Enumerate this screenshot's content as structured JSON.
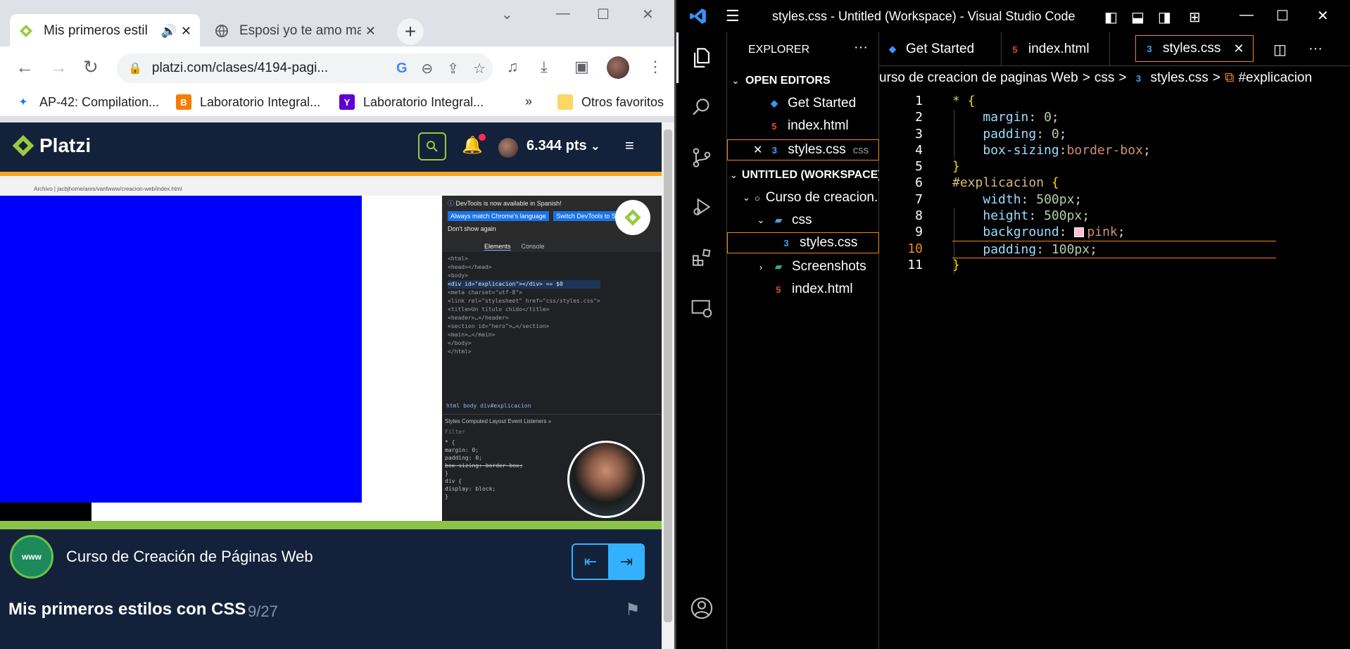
{
  "chrome": {
    "tabs": [
      {
        "title": "Mis primeros estil",
        "active": true
      },
      {
        "title": "Esposi yo te amo mas",
        "active": false
      }
    ],
    "url": "platzi.com/clases/4194-pagi...",
    "bookmarks": [
      {
        "label": "AP-42: Compilation..."
      },
      {
        "label": "Laboratorio Integral..."
      },
      {
        "label": "Laboratorio Integral..."
      },
      {
        "label": "Otros favoritos"
      }
    ],
    "bookmarks_more": "»"
  },
  "platzi": {
    "logo": "Platzi",
    "points": "6.344 pts",
    "course_title": "Curso de Creación de Páginas Web",
    "course_icon_text": "www",
    "class_title": "Mis primeros estilos con CSS",
    "class_count": "9/27"
  },
  "video": {
    "url_text": "Archivo | jacbjhome/ares/vanfwww/creacion-web/index.html",
    "devtools_banner": "DevTools is now available in Spanish!",
    "btn_match": "Always match Chrome's language",
    "btn_switch": "Switch DevTools to Spanish",
    "dont_show": "Don't show again",
    "tab_elements": "Elements",
    "tab_console": "Console",
    "code_lines": [
      "<html>",
      "  <head></head>",
      "  <body>",
      "    <div id=\"explicacion\"></div> == $0",
      "    <meta charset=\"utf-8\">",
      "    <link rel=\"stylesheet\" href=\"css/styles.css\">",
      "    <title>Un título chido</title>",
      "    <header>…</header>",
      "    <section id=\"hero\">…</section>",
      "    <main>…</main>",
      "  </body>",
      "</html>"
    ],
    "breadcrumb": "html  body  div#explicacion",
    "styles_tabs": "Styles   Computed   Layout   Event Listeners  »",
    "filter": "Filter",
    "style_lines": [
      "* {",
      "  margin: 0;",
      "  padding: 0;",
      "  box-sizing: border-box;",
      "}",
      "div {",
      "  display: block;",
      "}"
    ]
  },
  "vscode": {
    "window_title": "styles.css - Untitled (Workspace) - Visual Studio Code",
    "explorer_title": "EXPLORER",
    "open_editors_label": "OPEN EDITORS",
    "workspace_label": "UNTITLED (WORKSPACE)",
    "open_editors": [
      {
        "name": "Get Started",
        "icon": "vscode-icon"
      },
      {
        "name": "index.html",
        "icon": "html-icon"
      },
      {
        "name": "styles.css",
        "icon": "css-icon",
        "suffix": "css"
      }
    ],
    "tree": [
      {
        "name": "Curso de creacion...",
        "icon": "circle-icon"
      },
      {
        "name": "css",
        "icon": "folder-icon"
      },
      {
        "name": "styles.css",
        "icon": "css-icon"
      },
      {
        "name": "Screenshots",
        "icon": "folder-icon"
      },
      {
        "name": "index.html",
        "icon": "html-icon"
      }
    ],
    "tabs": [
      {
        "name": "Get Started"
      },
      {
        "name": "index.html"
      },
      {
        "name": "styles.css"
      }
    ],
    "breadcrumbs": [
      "urso de creacion de paginas Web",
      ">",
      "css",
      ">",
      "styles.css",
      ">",
      "#explicacion"
    ],
    "code": [
      {
        "n": "1"
      },
      {
        "n": "2"
      },
      {
        "n": "3"
      },
      {
        "n": "4"
      },
      {
        "n": "5"
      },
      {
        "n": "6"
      },
      {
        "n": "7"
      },
      {
        "n": "8"
      },
      {
        "n": "9"
      },
      {
        "n": "10"
      },
      {
        "n": "11"
      }
    ],
    "code_text": {
      "l1_sel": "*",
      "l1_brace": "{",
      "l2_prop": "margin",
      "l2_val": "0",
      "l3_prop": "padding",
      "l3_val": "0",
      "l4_prop": "box-sizing",
      "l4_val": "border-box",
      "l5": "}",
      "l6_sel": "#explicacion",
      "l6_brace": "{",
      "l7_prop": "width",
      "l7_val": "500px",
      "l8_prop": "height",
      "l8_val": "500px",
      "l9_prop": "background",
      "l9_val": "pink",
      "l10_prop": "padding",
      "l10_val": "100px",
      "l11": "}"
    },
    "current_line": "10"
  },
  "colors": {
    "platzi_navy": "#13223a",
    "platzi_green": "#98ca3f",
    "vscode_accent": "#f38518"
  }
}
